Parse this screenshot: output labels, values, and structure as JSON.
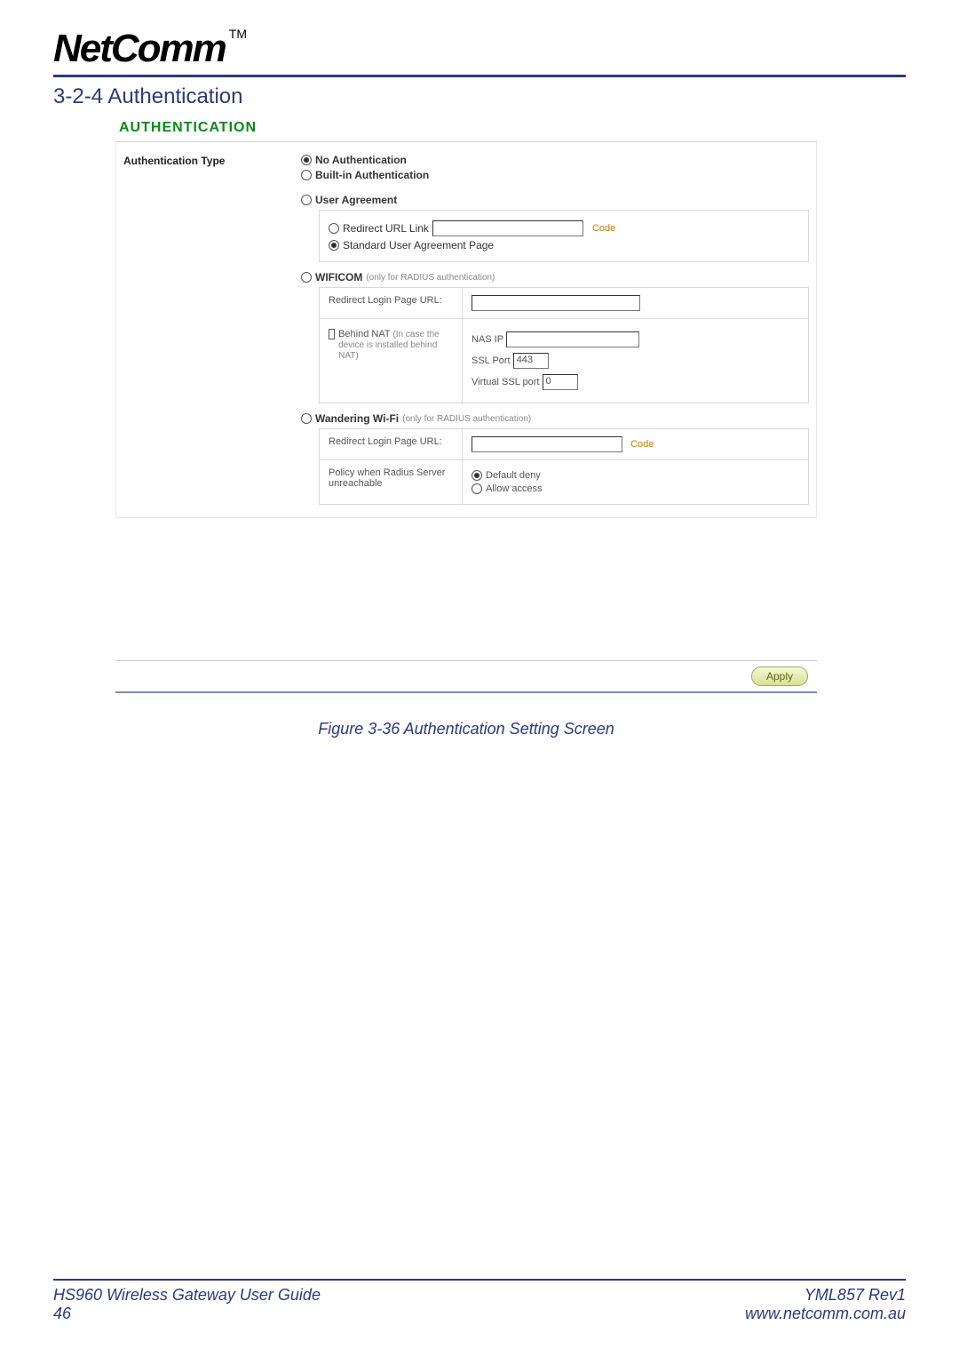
{
  "header": {
    "brand": "NetComm",
    "tm": "TM",
    "section_heading": "3-2-4 Authentication"
  },
  "panel": {
    "title": "AUTHENTICATION",
    "type_label": "Authentication Type",
    "no_auth": "No Authentication",
    "builtin": "Built-in Authentication",
    "user_agreement": "User Agreement",
    "ua_redirect_label": "Redirect URL Link",
    "ua_redirect_value": "",
    "ua_code": "Code",
    "ua_standard": "Standard User Agreement Page",
    "wificom": "WIFICOM",
    "wificom_note": "(only for RADIUS authentication)",
    "wificom_redirect_label": "Redirect Login Page URL:",
    "wificom_redirect_value": "",
    "wificom_behind_nat": "Behind NAT",
    "wificom_behind_nat_note": "(In case the device is installed behind NAT)",
    "wificom_nasip_label": "NAS IP",
    "wificom_nasip_value": "",
    "wificom_sslport_label": "SSL Port",
    "wificom_sslport_value": "443",
    "wificom_vsslport_label": "Virtual SSL port",
    "wificom_vsslport_value": "0",
    "wandering": "Wandering Wi-Fi",
    "wandering_note": "(only for RADIUS authentication)",
    "wandering_redirect_label": "Redirect Login Page URL:",
    "wandering_redirect_value": "",
    "wandering_code": "Code",
    "wandering_policy_label": "Policy when Radius Server unreachable",
    "wandering_policy_deny": "Default deny",
    "wandering_policy_allow": "Allow access",
    "apply": "Apply"
  },
  "caption": "Figure 3-36 Authentication Setting Screen",
  "footer": {
    "guide": "HS960 Wireless Gateway User Guide",
    "page": "46",
    "doc": "YML857 Rev1",
    "url": "www.netcomm.com.au"
  }
}
